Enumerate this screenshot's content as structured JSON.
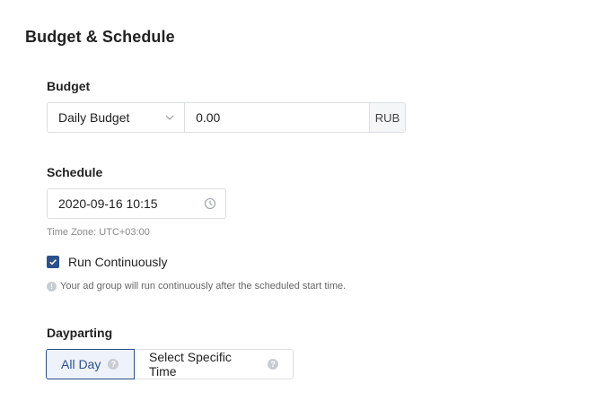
{
  "section": {
    "title": "Budget & Schedule"
  },
  "budget": {
    "label": "Budget",
    "type_selected": "Daily Budget",
    "amount_value": "0.00",
    "currency": "RUB"
  },
  "schedule": {
    "label": "Schedule",
    "start_datetime": "2020-09-16 10:15",
    "timezone": "Time Zone: UTC+03:00",
    "run_continuously_label": "Run Continuously",
    "run_continuously_checked": true,
    "hint": "Your ad group will run continuously after the scheduled start time."
  },
  "dayparting": {
    "label": "Dayparting",
    "options": [
      {
        "label": "All Day",
        "active": true
      },
      {
        "label": "Select Specific Time",
        "active": false
      }
    ]
  },
  "colors": {
    "accent": "#2b4f8f",
    "border": "#dcdfe6",
    "muted_text": "#888888"
  },
  "icons": {
    "dropdown": "chevron-down-icon",
    "clock": "clock-icon",
    "checkbox": "check-icon",
    "info": "info-icon",
    "help": "question-icon"
  }
}
